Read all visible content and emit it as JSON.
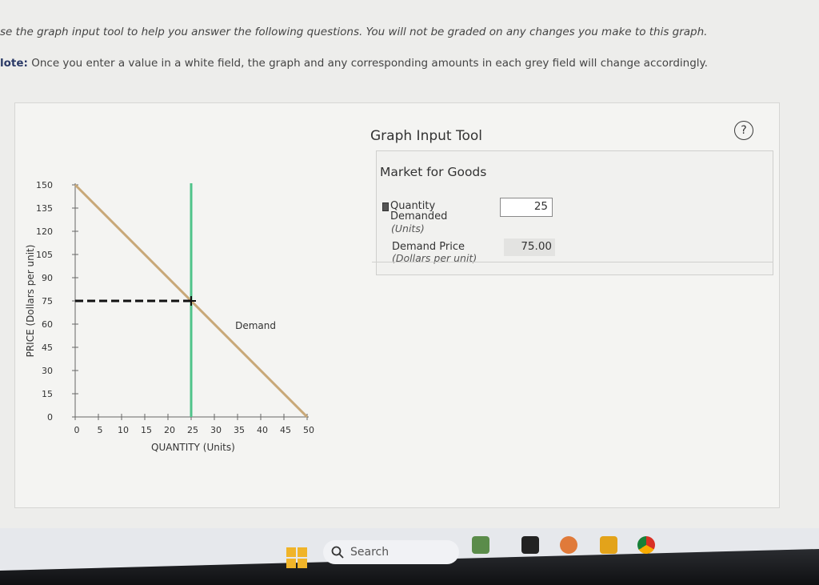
{
  "instructions": "se the graph input tool to help you answer the following questions. You will not be graded on any changes you make to this graph.",
  "note_label": "lote:",
  "note_text": " Once you enter a value in a white field, the graph and any corresponding amounts in each grey field will change accordingly.",
  "tool": {
    "title": "Graph Input Tool",
    "help_glyph": "?",
    "market_title": "Market for Goods",
    "quantity_label_1": "Quantity",
    "quantity_label_2": "Demanded",
    "quantity_units": "(Units)",
    "quantity_value": "25",
    "price_label": "Demand Price",
    "price_units": "(Dollars per unit)",
    "price_value": "75.00"
  },
  "taskbar": {
    "search_placeholder": "Search",
    "icons": [
      "windows-start-icon",
      "search-icon",
      "widgets-icon",
      "file-explorer-icon",
      "app-icon",
      "word-icon",
      "chrome-icon"
    ]
  },
  "chart_data": {
    "type": "line",
    "ylabel": "PRICE (Dollars per unit)",
    "xlabel": "QUANTITY (Units)",
    "x_ticks": [
      0,
      5,
      10,
      15,
      20,
      25,
      30,
      35,
      40,
      45,
      50
    ],
    "y_ticks": [
      0,
      15,
      30,
      45,
      60,
      75,
      90,
      105,
      120,
      135,
      150
    ],
    "xlim": [
      0,
      50
    ],
    "ylim": [
      0,
      150
    ],
    "series": [
      {
        "name": "Demand",
        "x": [
          0,
          50
        ],
        "y": [
          150,
          0
        ],
        "color": "#c8a878"
      }
    ],
    "vertical_line_x": 25,
    "vertical_line_color": "#4fc38a",
    "point": {
      "x": 25,
      "y": 75
    },
    "dashed_price": 75
  }
}
